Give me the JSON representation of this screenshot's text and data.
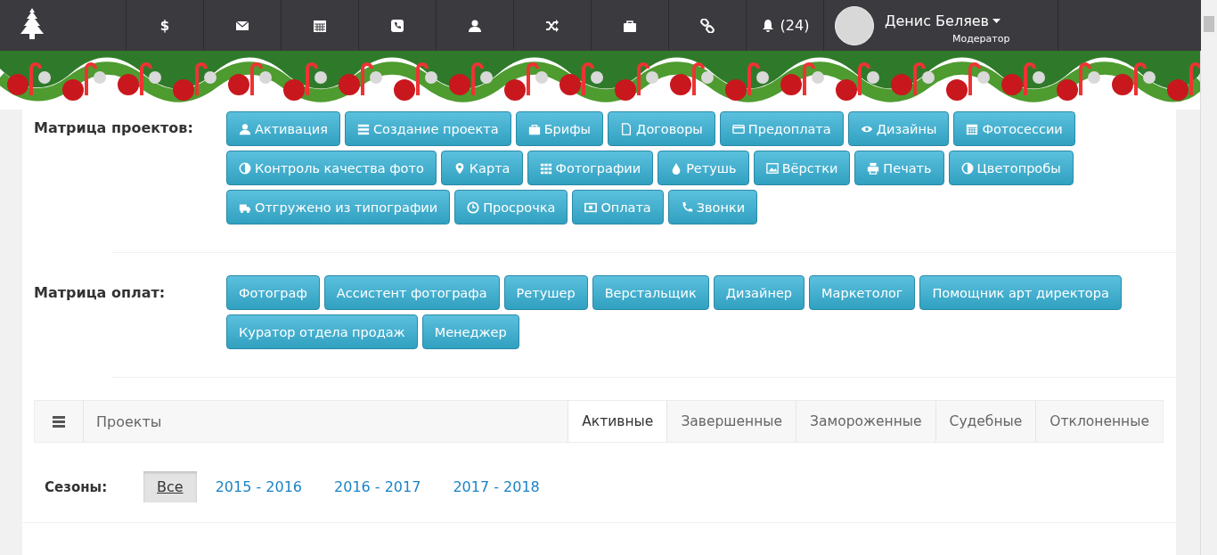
{
  "topbar": {
    "nav": [
      {
        "kind": "text",
        "text": "$"
      },
      {
        "kind": "icon"
      },
      {
        "kind": "icon"
      },
      {
        "kind": "icon"
      },
      {
        "kind": "icon"
      },
      {
        "kind": "icon"
      },
      {
        "kind": "icon"
      },
      {
        "kind": "icon"
      },
      {
        "kind": "bell",
        "text": "(24)"
      }
    ],
    "user": {
      "name": "Денис Беляев",
      "role": "Модератор"
    }
  },
  "project_matrix": {
    "label": "Матрица проектов:",
    "buttons": [
      "Активация",
      "Создание проекта",
      "Брифы",
      "Договоры",
      "Предоплата",
      "Дизайны",
      "Фотосессии",
      "Контроль качества фото",
      "Карта",
      "Фотографии",
      "Ретушь",
      "Вёрстки",
      "Печать",
      "Цветопробы",
      "Отгружено из типографии",
      "Просрочка",
      "Оплата",
      "Звонки"
    ]
  },
  "payment_matrix": {
    "label": "Матрица оплат:",
    "buttons": [
      "Фотограф",
      "Ассистент фотографа",
      "Ретушер",
      "Верстальщик",
      "Дизайнер",
      "Маркетолог",
      "Помощник арт директора",
      "Куратор отдела продаж",
      "Менеджер"
    ]
  },
  "projects_panel": {
    "title": "Проекты",
    "tabs": [
      {
        "label": "Активные",
        "selected": true
      },
      {
        "label": "Завершенные",
        "selected": false
      },
      {
        "label": "Замороженные",
        "selected": false
      },
      {
        "label": "Судебные",
        "selected": false
      },
      {
        "label": "Отклоненные",
        "selected": false
      }
    ]
  },
  "seasons": {
    "label": "Сезоны:",
    "items": [
      {
        "label": "Все",
        "selected": true
      },
      {
        "label": "2015 - 2016",
        "selected": false
      },
      {
        "label": "2016 - 2017",
        "selected": false
      },
      {
        "label": "2017 - 2018",
        "selected": false
      }
    ]
  }
}
